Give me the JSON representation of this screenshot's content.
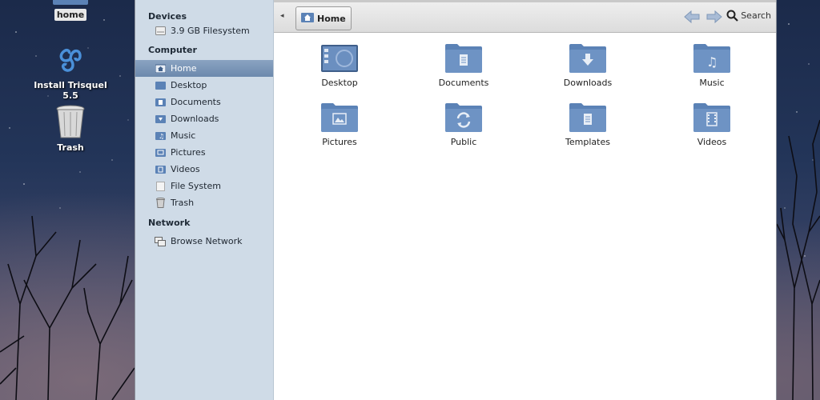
{
  "desktop": {
    "icons": [
      {
        "label": "home"
      },
      {
        "label": "Install Trisquel 5.5"
      },
      {
        "label": "Trash"
      }
    ]
  },
  "sidebar": {
    "sections": [
      {
        "title": "Devices",
        "items": [
          {
            "label": "3.9 GB Filesystem"
          }
        ]
      },
      {
        "title": "Computer",
        "items": [
          {
            "label": "Home"
          },
          {
            "label": "Desktop"
          },
          {
            "label": "Documents"
          },
          {
            "label": "Downloads"
          },
          {
            "label": "Music"
          },
          {
            "label": "Pictures"
          },
          {
            "label": "Videos"
          },
          {
            "label": "File System"
          },
          {
            "label": "Trash"
          }
        ]
      },
      {
        "title": "Network",
        "items": [
          {
            "label": "Browse Network"
          }
        ]
      }
    ]
  },
  "toolbar": {
    "path_label": "Home",
    "search_label": "Search"
  },
  "folders": [
    {
      "label": "Desktop"
    },
    {
      "label": "Documents"
    },
    {
      "label": "Downloads"
    },
    {
      "label": "Music"
    },
    {
      "label": "Pictures"
    },
    {
      "label": "Public"
    },
    {
      "label": "Templates"
    },
    {
      "label": "Videos"
    }
  ],
  "colors": {
    "folder": "#5b82b6",
    "sidebar_bg": "#cfdbe7",
    "selection": "#7891b3"
  }
}
